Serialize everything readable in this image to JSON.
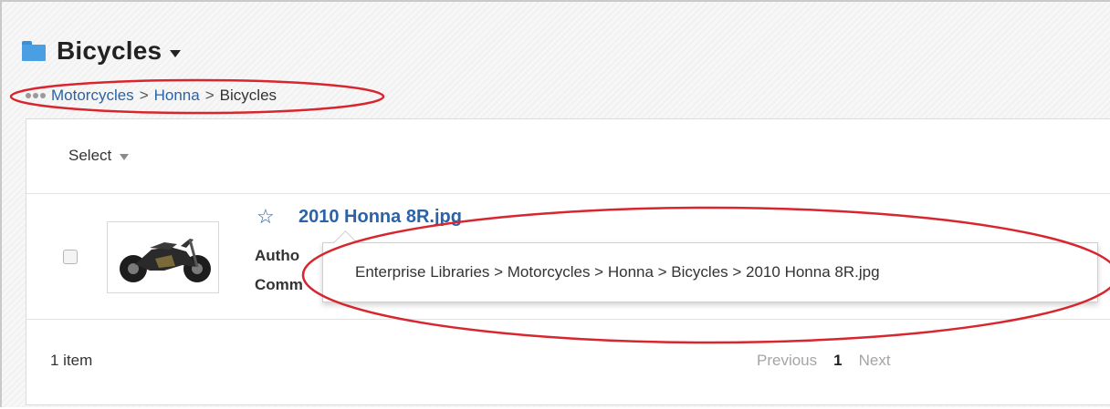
{
  "header": {
    "title": "Bicycles",
    "folder_icon": "folder-icon",
    "accent_color": "#4a9ee2"
  },
  "breadcrumb": {
    "items": [
      "Motorcycles",
      "Honna",
      "Bicycles"
    ],
    "separator": ">"
  },
  "toolbar": {
    "select_label": "Select"
  },
  "items": [
    {
      "name": "2010 Honna 8R.jpg",
      "meta_labels": [
        "Autho",
        "Comm"
      ],
      "tooltip_path": "Enterprise Libraries > Motorcycles > Honna > Bicycles > 2010 Honna 8R.jpg"
    }
  ],
  "footer": {
    "count_label": "1 item",
    "pager": {
      "previous": "Previous",
      "current_page": "1",
      "next": "Next"
    }
  },
  "colors": {
    "link": "#2b63a6",
    "annotation": "#d7262e"
  }
}
